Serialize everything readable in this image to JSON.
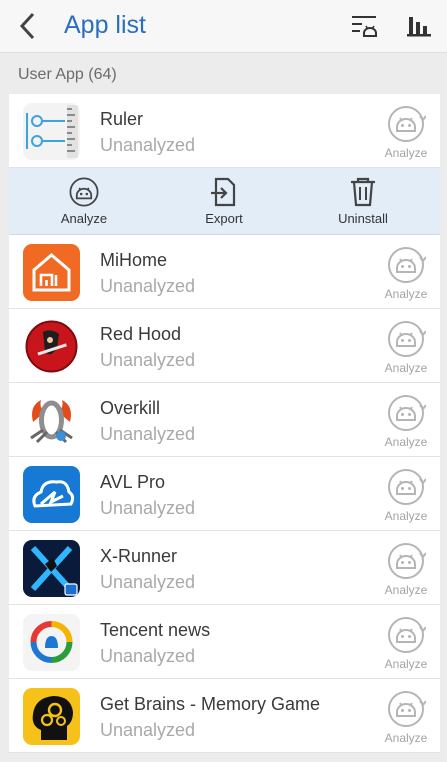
{
  "header": {
    "title": "App list",
    "back_icon": "back-arrow-icon",
    "filter_icon": "filter-android-icon",
    "stats_icon": "bar-chart-icon"
  },
  "section": {
    "label": "User App (64)"
  },
  "actions": {
    "analyze": "Analyze",
    "export": "Export",
    "uninstall": "Uninstall"
  },
  "apps": [
    {
      "name": "Ruler",
      "status": "Unanalyzed",
      "analyze": "Analyze",
      "icon": "ruler-app-icon"
    },
    {
      "name": "MiHome",
      "status": "Unanalyzed",
      "analyze": "Analyze",
      "icon": "mihome-app-icon"
    },
    {
      "name": "Red Hood",
      "status": "Unanalyzed",
      "analyze": "Analyze",
      "icon": "red-hood-app-icon"
    },
    {
      "name": "Overkill",
      "status": "Unanalyzed",
      "analyze": "Analyze",
      "icon": "overkill-app-icon"
    },
    {
      "name": "AVL Pro",
      "status": "Unanalyzed",
      "analyze": "Analyze",
      "icon": "avl-pro-app-icon"
    },
    {
      "name": "X-Runner",
      "status": "Unanalyzed",
      "analyze": "Analyze",
      "icon": "x-runner-app-icon"
    },
    {
      "name": "Tencent news",
      "status": "Unanalyzed",
      "analyze": "Analyze",
      "icon": "tencent-news-app-icon"
    },
    {
      "name": "Get Brains - Memory Game",
      "status": "Unanalyzed",
      "analyze": "Analyze",
      "icon": "get-brains-app-icon"
    }
  ],
  "colors": {
    "accent": "#2a6fbf",
    "action_bar": "#e3edf8",
    "muted": "#a9a9a9"
  }
}
